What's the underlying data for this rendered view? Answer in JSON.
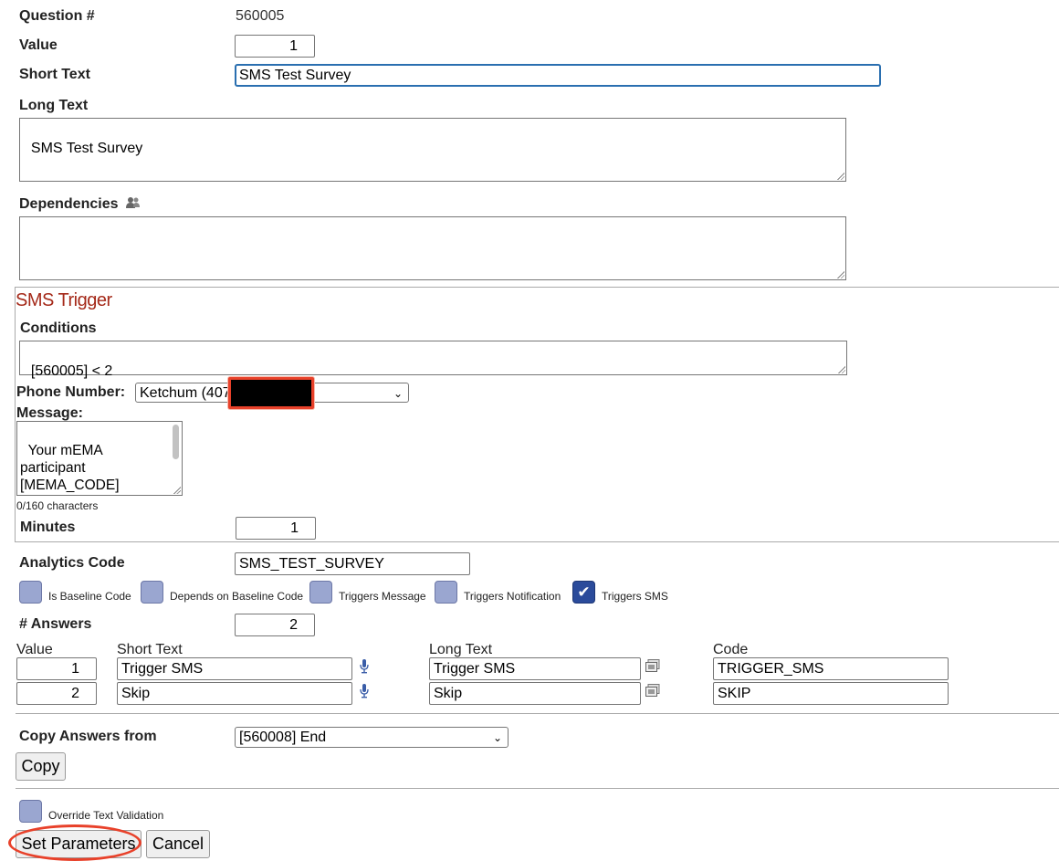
{
  "question": {
    "number_label": "Question #",
    "number_value": "560005",
    "value_label": "Value",
    "value": "1",
    "short_text_label": "Short Text",
    "short_text": "SMS Test Survey",
    "long_text_label": "Long Text",
    "long_text": "SMS Test Survey",
    "dependencies_label": "Dependencies",
    "dependencies": ""
  },
  "sms_trigger": {
    "title": "SMS Trigger",
    "conditions_label": "Conditions",
    "conditions": "[560005] < 2",
    "phone_label": "Phone Number:",
    "phone_value": "Ketchum (407",
    "message_label": "Message:",
    "message": "Your mEMA\nparticipant\n[MEMA_CODE]\nresponded to a high",
    "char_count": "0/160 characters",
    "minutes_label": "Minutes",
    "minutes": "1"
  },
  "analytics": {
    "label": "Analytics Code",
    "value": "SMS_TEST_SURVEY"
  },
  "flags": [
    {
      "label": "Is Baseline Code",
      "checked": false
    },
    {
      "label": "Depends on Baseline Code",
      "checked": false
    },
    {
      "label": "Triggers Message",
      "checked": false
    },
    {
      "label": "Triggers Notification",
      "checked": false
    },
    {
      "label": "Triggers SMS",
      "checked": true
    }
  ],
  "answers": {
    "count_label": "# Answers",
    "count": "2",
    "headers": {
      "value": "Value",
      "short_text": "Short Text",
      "long_text": "Long Text",
      "code": "Code"
    },
    "rows": [
      {
        "value": "1",
        "short_text": "Trigger SMS",
        "long_text": "Trigger SMS",
        "code": "TRIGGER_SMS"
      },
      {
        "value": "2",
        "short_text": "Skip",
        "long_text": "Skip",
        "code": "SKIP"
      }
    ]
  },
  "copy": {
    "label": "Copy Answers from",
    "selected": "[560008] End",
    "button": "Copy"
  },
  "override": {
    "label": "Override Text Validation",
    "checked": false
  },
  "actions": {
    "set_parameters": "Set Parameters",
    "cancel": "Cancel"
  },
  "colors": {
    "sms_title": "#a52a1a",
    "checkbox": "#9aa6d0",
    "checkbox_checked": "#2b4b9b",
    "highlight": "#e8412a"
  }
}
